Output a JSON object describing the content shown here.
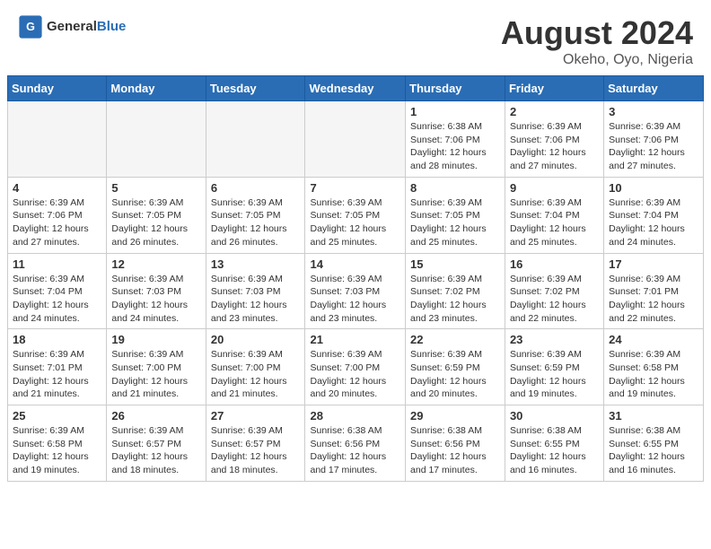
{
  "header": {
    "logo_general": "General",
    "logo_blue": "Blue",
    "title": "August 2024",
    "location": "Okeho, Oyo, Nigeria"
  },
  "weekdays": [
    "Sunday",
    "Monday",
    "Tuesday",
    "Wednesday",
    "Thursday",
    "Friday",
    "Saturday"
  ],
  "weeks": [
    [
      {
        "day": "",
        "info": ""
      },
      {
        "day": "",
        "info": ""
      },
      {
        "day": "",
        "info": ""
      },
      {
        "day": "",
        "info": ""
      },
      {
        "day": "1",
        "info": "Sunrise: 6:38 AM\nSunset: 7:06 PM\nDaylight: 12 hours and 28 minutes."
      },
      {
        "day": "2",
        "info": "Sunrise: 6:39 AM\nSunset: 7:06 PM\nDaylight: 12 hours and 27 minutes."
      },
      {
        "day": "3",
        "info": "Sunrise: 6:39 AM\nSunset: 7:06 PM\nDaylight: 12 hours and 27 minutes."
      }
    ],
    [
      {
        "day": "4",
        "info": "Sunrise: 6:39 AM\nSunset: 7:06 PM\nDaylight: 12 hours and 27 minutes."
      },
      {
        "day": "5",
        "info": "Sunrise: 6:39 AM\nSunset: 7:05 PM\nDaylight: 12 hours and 26 minutes."
      },
      {
        "day": "6",
        "info": "Sunrise: 6:39 AM\nSunset: 7:05 PM\nDaylight: 12 hours and 26 minutes."
      },
      {
        "day": "7",
        "info": "Sunrise: 6:39 AM\nSunset: 7:05 PM\nDaylight: 12 hours and 25 minutes."
      },
      {
        "day": "8",
        "info": "Sunrise: 6:39 AM\nSunset: 7:05 PM\nDaylight: 12 hours and 25 minutes."
      },
      {
        "day": "9",
        "info": "Sunrise: 6:39 AM\nSunset: 7:04 PM\nDaylight: 12 hours and 25 minutes."
      },
      {
        "day": "10",
        "info": "Sunrise: 6:39 AM\nSunset: 7:04 PM\nDaylight: 12 hours and 24 minutes."
      }
    ],
    [
      {
        "day": "11",
        "info": "Sunrise: 6:39 AM\nSunset: 7:04 PM\nDaylight: 12 hours and 24 minutes."
      },
      {
        "day": "12",
        "info": "Sunrise: 6:39 AM\nSunset: 7:03 PM\nDaylight: 12 hours and 24 minutes."
      },
      {
        "day": "13",
        "info": "Sunrise: 6:39 AM\nSunset: 7:03 PM\nDaylight: 12 hours and 23 minutes."
      },
      {
        "day": "14",
        "info": "Sunrise: 6:39 AM\nSunset: 7:03 PM\nDaylight: 12 hours and 23 minutes."
      },
      {
        "day": "15",
        "info": "Sunrise: 6:39 AM\nSunset: 7:02 PM\nDaylight: 12 hours and 23 minutes."
      },
      {
        "day": "16",
        "info": "Sunrise: 6:39 AM\nSunset: 7:02 PM\nDaylight: 12 hours and 22 minutes."
      },
      {
        "day": "17",
        "info": "Sunrise: 6:39 AM\nSunset: 7:01 PM\nDaylight: 12 hours and 22 minutes."
      }
    ],
    [
      {
        "day": "18",
        "info": "Sunrise: 6:39 AM\nSunset: 7:01 PM\nDaylight: 12 hours and 21 minutes."
      },
      {
        "day": "19",
        "info": "Sunrise: 6:39 AM\nSunset: 7:00 PM\nDaylight: 12 hours and 21 minutes."
      },
      {
        "day": "20",
        "info": "Sunrise: 6:39 AM\nSunset: 7:00 PM\nDaylight: 12 hours and 21 minutes."
      },
      {
        "day": "21",
        "info": "Sunrise: 6:39 AM\nSunset: 7:00 PM\nDaylight: 12 hours and 20 minutes."
      },
      {
        "day": "22",
        "info": "Sunrise: 6:39 AM\nSunset: 6:59 PM\nDaylight: 12 hours and 20 minutes."
      },
      {
        "day": "23",
        "info": "Sunrise: 6:39 AM\nSunset: 6:59 PM\nDaylight: 12 hours and 19 minutes."
      },
      {
        "day": "24",
        "info": "Sunrise: 6:39 AM\nSunset: 6:58 PM\nDaylight: 12 hours and 19 minutes."
      }
    ],
    [
      {
        "day": "25",
        "info": "Sunrise: 6:39 AM\nSunset: 6:58 PM\nDaylight: 12 hours and 19 minutes."
      },
      {
        "day": "26",
        "info": "Sunrise: 6:39 AM\nSunset: 6:57 PM\nDaylight: 12 hours and 18 minutes."
      },
      {
        "day": "27",
        "info": "Sunrise: 6:39 AM\nSunset: 6:57 PM\nDaylight: 12 hours and 18 minutes."
      },
      {
        "day": "28",
        "info": "Sunrise: 6:38 AM\nSunset: 6:56 PM\nDaylight: 12 hours and 17 minutes."
      },
      {
        "day": "29",
        "info": "Sunrise: 6:38 AM\nSunset: 6:56 PM\nDaylight: 12 hours and 17 minutes."
      },
      {
        "day": "30",
        "info": "Sunrise: 6:38 AM\nSunset: 6:55 PM\nDaylight: 12 hours and 16 minutes."
      },
      {
        "day": "31",
        "info": "Sunrise: 6:38 AM\nSunset: 6:55 PM\nDaylight: 12 hours and 16 minutes."
      }
    ]
  ]
}
